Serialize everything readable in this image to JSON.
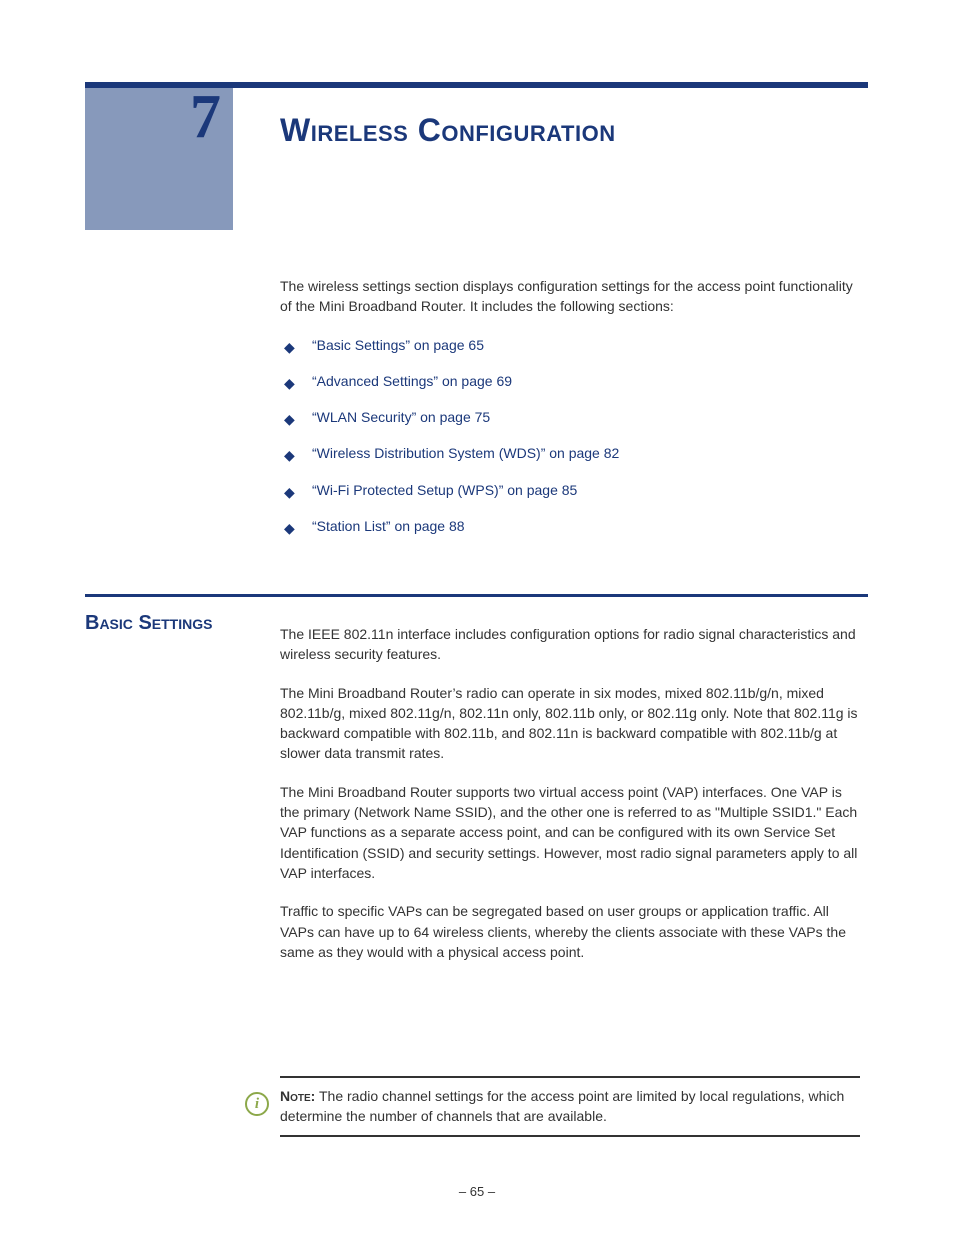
{
  "chapter": {
    "number": "7",
    "title": "Wireless Configuration"
  },
  "intro": "The wireless settings section displays configuration settings for the access point functionality of the Mini Broadband Router. It includes the following sections:",
  "links": [
    "“Basic Settings” on page 65",
    "“Advanced Settings” on page 69",
    "“WLAN Security” on page 75",
    "“Wireless Distribution System (WDS)” on page 82",
    "“Wi-Fi Protected Setup (WPS)” on page 85",
    "“Station List” on page 88"
  ],
  "section": {
    "heading": "Basic Settings",
    "paragraphs": [
      "The IEEE 802.11n interface includes configuration options for radio signal characteristics and wireless security features.",
      "The Mini Broadband Router’s radio can operate in six modes, mixed 802.11b/g/n, mixed 802.11b/g, mixed 802.11g/n, 802.11n only, 802.11b only, or 802.11g only. Note that 802.11g is backward compatible with 802.11b, and 802.11n is backward compatible with 802.11b/g at slower data transmit rates.",
      "The Mini Broadband Router supports two virtual access point (VAP) interfaces. One VAP is the primary (Network Name SSID), and the other one is referred to as \"Multiple SSID1.\" Each VAP functions as a separate access point, and can be configured with its own Service Set Identification (SSID) and security settings. However, most radio signal parameters apply to all VAP interfaces.",
      "Traffic to specific VAPs can be segregated based on user groups or application traffic. All VAPs can have up to 64 wireless clients, whereby the clients associate with these VAPs the same as they would with a physical access point."
    ]
  },
  "note": {
    "label": "Note:",
    "text": " The radio channel settings for the access point are limited by local regulations, which determine the number of channels that are available."
  },
  "footer": {
    "page": "–  65  –"
  }
}
